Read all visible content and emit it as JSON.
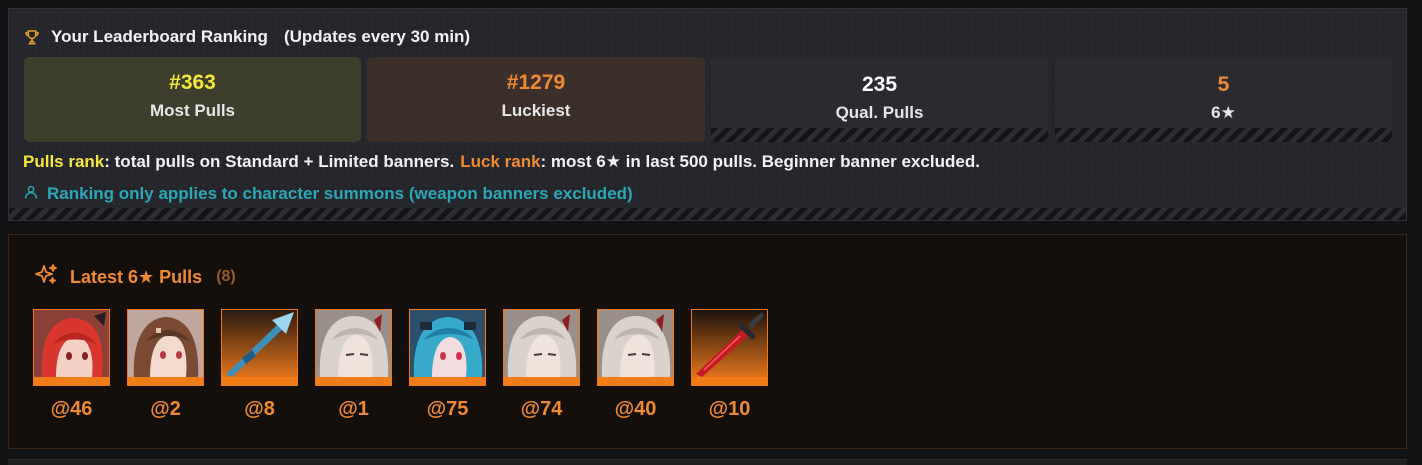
{
  "ranking": {
    "title": "Your Leaderboard Ranking",
    "updates": "(Updates every 30 min)",
    "stats": [
      {
        "value": "#363",
        "label": "Most Pulls"
      },
      {
        "value": "#1279",
        "label": "Luckiest"
      },
      {
        "value": "235",
        "label": "Qual. Pulls"
      },
      {
        "value": "5",
        "label": "6★"
      }
    ],
    "desc": {
      "pulls_label": "Pulls rank",
      "pulls_text": ": total pulls on Standard + Limited banners.",
      "luck_label": "Luck rank",
      "luck_text": ": most 6★ in last 500 pulls. Beginner banner excluded."
    },
    "note": "Ranking only applies to character summons (weapon banners excluded)"
  },
  "latest": {
    "title": "Latest 6★ Pulls",
    "count": "(8)",
    "pulls": [
      {
        "at": "@46",
        "kind": "character",
        "name": "red-haired-character-portrait"
      },
      {
        "at": "@2",
        "kind": "character",
        "name": "brown-haired-character-portrait"
      },
      {
        "at": "@8",
        "kind": "weapon",
        "name": "blue-spear-weapon"
      },
      {
        "at": "@1",
        "kind": "character",
        "name": "silver-haired-character-portrait"
      },
      {
        "at": "@75",
        "kind": "character",
        "name": "teal-haired-character-portrait"
      },
      {
        "at": "@74",
        "kind": "character",
        "name": "silver-haired-character-portrait"
      },
      {
        "at": "@40",
        "kind": "character",
        "name": "silver-haired-character-portrait"
      },
      {
        "at": "@10",
        "kind": "weapon",
        "name": "crimson-sword-weapon"
      }
    ]
  },
  "colors": {
    "accent_orange": "#f08a32",
    "accent_yellow": "#f5e73c",
    "accent_teal": "#2aa7b8"
  },
  "icons": {
    "trophy": "trophy-icon",
    "sparkles": "sparkles-icon",
    "user": "user-icon"
  }
}
